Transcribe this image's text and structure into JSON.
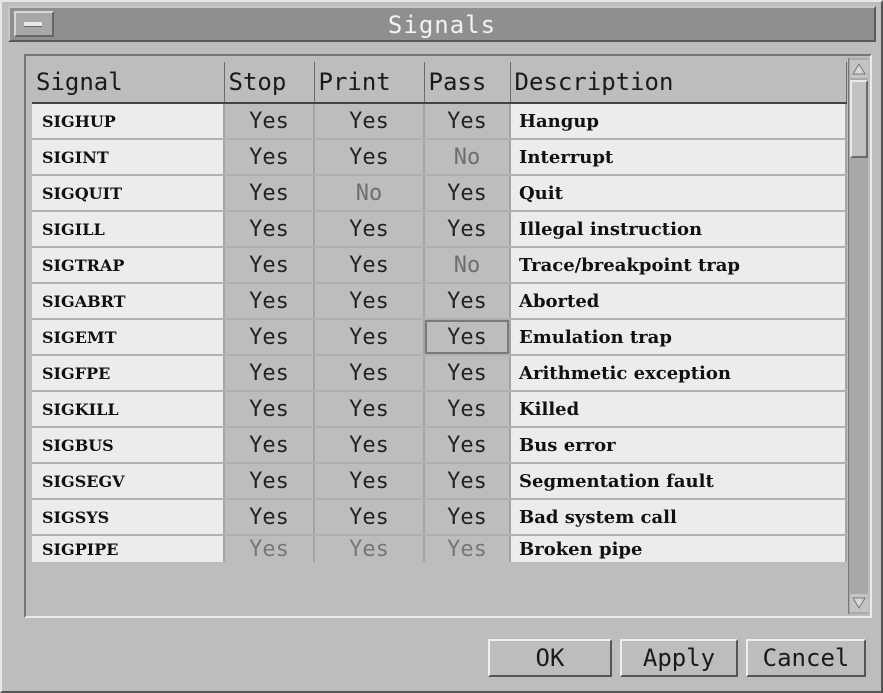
{
  "window": {
    "title": "Signals"
  },
  "table": {
    "columns": [
      "Signal",
      "Stop",
      "Print",
      "Pass",
      "Description"
    ],
    "rows": [
      [
        "SIGHUP",
        "Yes",
        "Yes",
        "Yes",
        "Hangup"
      ],
      [
        "SIGINT",
        "Yes",
        "Yes",
        "No",
        "Interrupt"
      ],
      [
        "SIGQUIT",
        "Yes",
        "No",
        "Yes",
        "Quit"
      ],
      [
        "SIGILL",
        "Yes",
        "Yes",
        "Yes",
        "Illegal instruction"
      ],
      [
        "SIGTRAP",
        "Yes",
        "Yes",
        "No",
        "Trace/breakpoint trap"
      ],
      [
        "SIGABRT",
        "Yes",
        "Yes",
        "Yes",
        "Aborted"
      ],
      [
        "SIGEMT",
        "Yes",
        "Yes",
        "Yes",
        "Emulation trap"
      ],
      [
        "SIGFPE",
        "Yes",
        "Yes",
        "Yes",
        "Arithmetic exception"
      ],
      [
        "SIGKILL",
        "Yes",
        "Yes",
        "Yes",
        "Killed"
      ],
      [
        "SIGBUS",
        "Yes",
        "Yes",
        "Yes",
        "Bus error"
      ],
      [
        "SIGSEGV",
        "Yes",
        "Yes",
        "Yes",
        "Segmentation fault"
      ],
      [
        "SIGSYS",
        "Yes",
        "Yes",
        "Yes",
        "Bad system call"
      ],
      [
        "SIGPIPE",
        "Yes",
        "Yes",
        "Yes",
        "Broken pipe"
      ]
    ]
  },
  "buttons": {
    "ok": "OK",
    "apply": "Apply",
    "cancel": "Cancel"
  },
  "icons": {
    "window_menu": "window-menu-icon",
    "scroll_up": "scroll-up-arrow-icon",
    "scroll_down": "scroll-down-arrow-icon"
  },
  "colors": {
    "background": "#bdbdbd",
    "titlebar": "#8f8f8f",
    "cell_text_bg": "#ececec"
  }
}
